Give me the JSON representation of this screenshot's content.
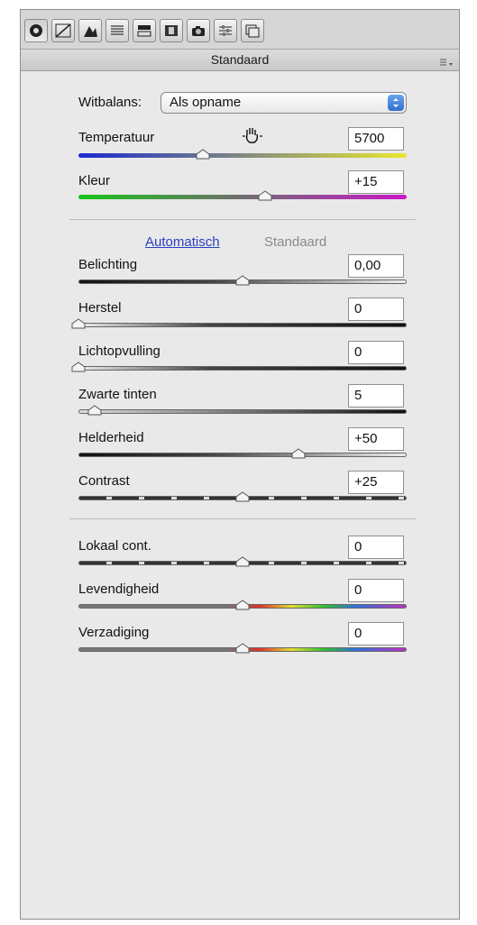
{
  "panel_title": "Standaard",
  "toolbar": {
    "icons": [
      "aperture-icon",
      "tone-curve-icon",
      "detail-icon",
      "hsl-icon",
      "split-toning-icon",
      "lens-corrections-icon",
      "camera-calibration-icon",
      "presets-icon",
      "snapshots-icon"
    ]
  },
  "white_balance": {
    "label": "Witbalans:",
    "value": "Als opname"
  },
  "temperature": {
    "label": "Temperatuur",
    "value": "5700",
    "level": 0.38
  },
  "tint": {
    "label": "Kleur",
    "value": "+15",
    "level": 0.57
  },
  "auto_link": "Automatisch",
  "default_link": "Standaard",
  "sliders": [
    {
      "label": "Belichting",
      "value": "0,00",
      "level": 0.5
    },
    {
      "label": "Herstel",
      "value": "0",
      "level": 0.0
    },
    {
      "label": "Lichtopvulling",
      "value": "0",
      "level": 0.0
    },
    {
      "label": "Zwarte tinten",
      "value": "5",
      "level": 0.05
    },
    {
      "label": "Helderheid",
      "value": "+50",
      "level": 0.67
    },
    {
      "label": "Contrast",
      "value": "+25",
      "level": 0.5
    }
  ],
  "presence": [
    {
      "label": "Lokaal cont.",
      "value": "0",
      "level": 0.5
    },
    {
      "label": "Levendigheid",
      "value": "0",
      "level": 0.5
    },
    {
      "label": "Verzadiging",
      "value": "0",
      "level": 0.5
    }
  ],
  "colors": {
    "temp_track": [
      "#1a2bd0",
      "#e8e830"
    ],
    "tint_track": [
      "#18c418",
      "#c818c8"
    ]
  }
}
